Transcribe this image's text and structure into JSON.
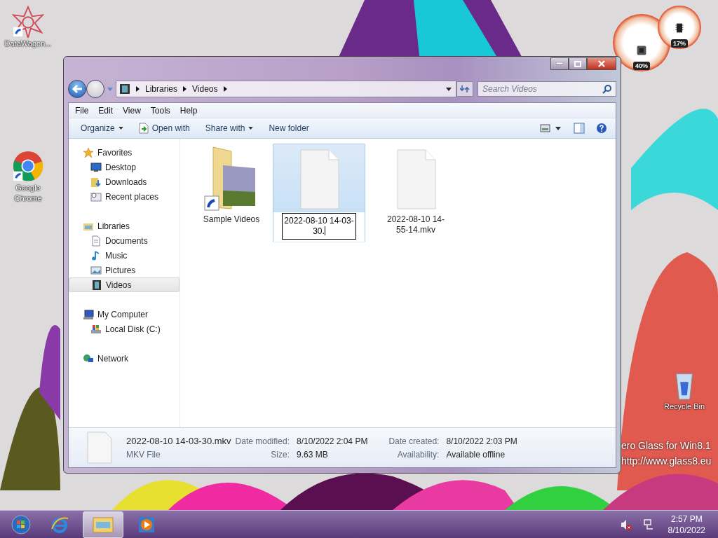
{
  "desktop_icons": [
    {
      "label": "DataWagon...",
      "kind": "star"
    },
    {
      "label": "Google Chrome",
      "kind": "browser"
    },
    {
      "label": "Recycle Bin",
      "kind": "bin"
    }
  ],
  "gadgets": [
    {
      "reading": "40%",
      "kind": "cpu"
    },
    {
      "reading": "17%",
      "kind": "memory"
    }
  ],
  "overlay_text": [
    "ero Glass for Win8.1",
    "http://www.glass8.eu"
  ],
  "window": {
    "address": [
      "Libraries",
      "Videos"
    ],
    "search": {
      "placeholder": "Search Videos"
    },
    "menu": [
      "File",
      "Edit",
      "View",
      "Tools",
      "Help"
    ],
    "commands": [
      {
        "label": "Organize",
        "kind": "dropdown"
      },
      {
        "label": "Open with",
        "kind": "open"
      },
      {
        "label": "Share with",
        "kind": "dropdown"
      },
      {
        "label": "New folder",
        "kind": "plain"
      }
    ],
    "nav": [
      {
        "label": "Favorites",
        "selected": false,
        "children": [
          {
            "label": "Desktop",
            "selected": false
          },
          {
            "label": "Downloads",
            "selected": false
          },
          {
            "label": "Recent places",
            "selected": false
          }
        ]
      },
      {
        "label": "Libraries",
        "selected": false,
        "children": [
          {
            "label": "Documents",
            "selected": false
          },
          {
            "label": "Music",
            "selected": false
          },
          {
            "label": "Pictures",
            "selected": false
          },
          {
            "label": "Videos",
            "selected": true
          }
        ]
      },
      {
        "label": "My Computer",
        "selected": false,
        "children": [
          {
            "label": "Local Disk (C:)",
            "selected": false
          }
        ]
      },
      {
        "label": "Network",
        "selected": false
      }
    ],
    "files": [
      {
        "name": "Sample Videos",
        "kind": "folder",
        "selected": false,
        "editing": false
      },
      {
        "name": "2022-08-10 14-03-30.",
        "kind": "file",
        "selected": true,
        "editing": true
      },
      {
        "name": "2022-08-10 14-55-14.mkv",
        "kind": "file",
        "selected": false,
        "editing": false
      }
    ],
    "details": {
      "name": "2022-08-10 14-03-30.mkv",
      "type": "MKV File",
      "fields": [
        {
          "label": "Date modified:",
          "value": "8/10/2022 2:04 PM"
        },
        {
          "label": "Date created:",
          "value": "8/10/2022 2:03 PM"
        },
        {
          "label": "Size:",
          "value": "9.63 MB"
        },
        {
          "label": "Availability:",
          "value": "Available offline"
        }
      ]
    }
  },
  "taskbar": {
    "apps": [
      {
        "kind": "ie",
        "selected": false
      },
      {
        "kind": "explorer",
        "selected": true
      },
      {
        "kind": "media",
        "selected": false
      }
    ],
    "clock": {
      "time": "2:57 PM",
      "date": "8/10/2022"
    }
  }
}
